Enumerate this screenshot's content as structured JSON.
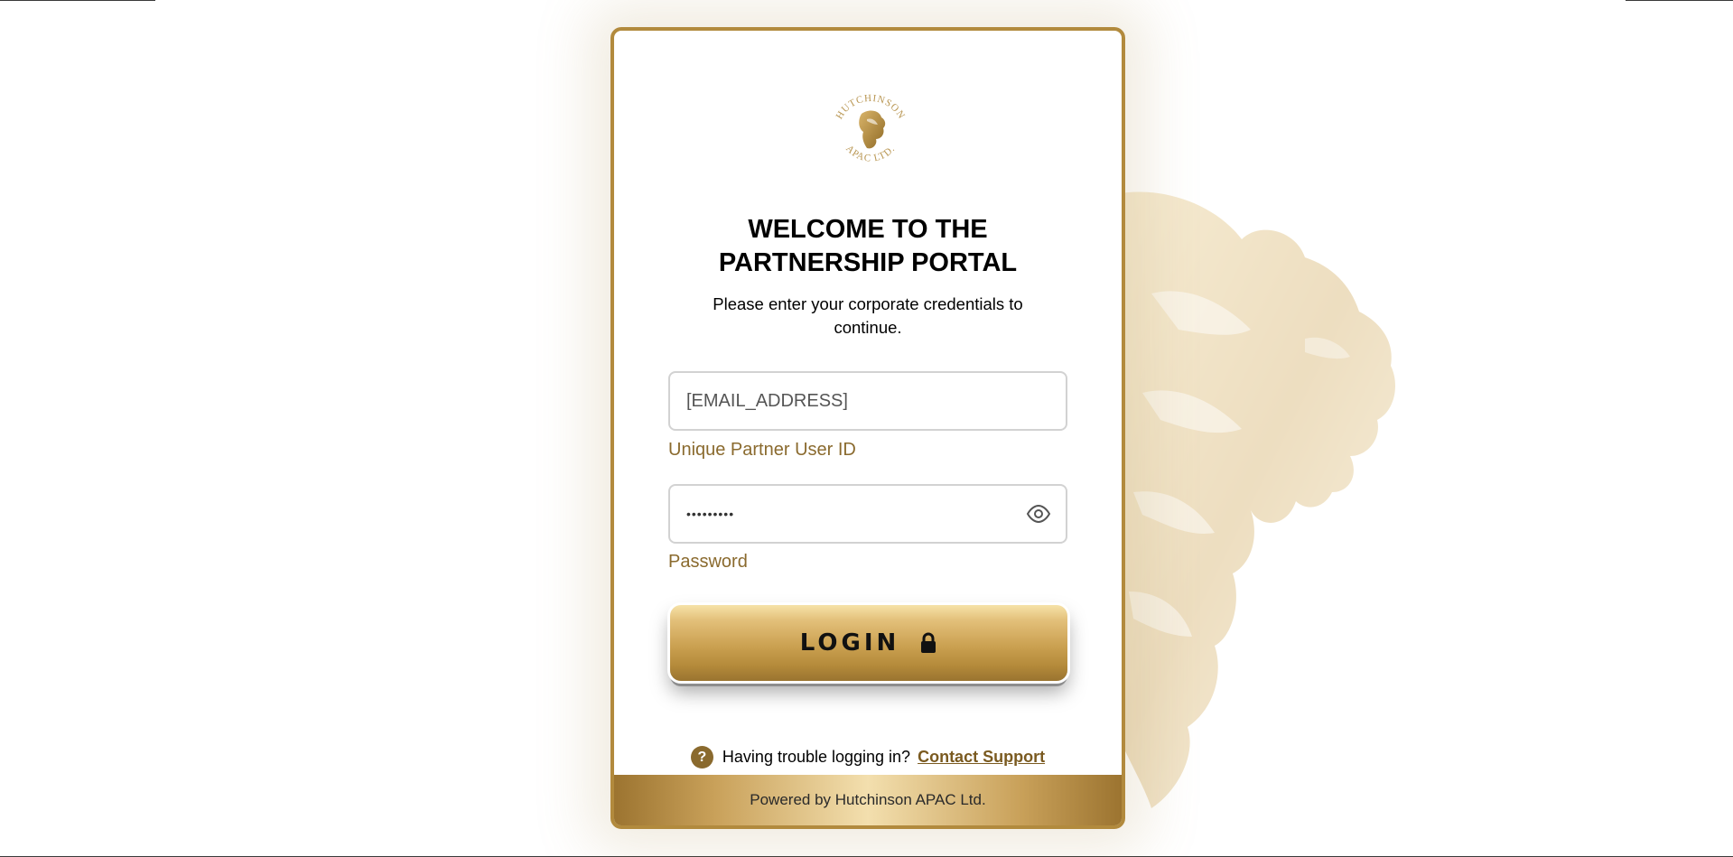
{
  "logo": {
    "arc_top": "HUTCHINSON",
    "arc_bottom": "APAC LTD."
  },
  "header": {
    "title": "WELCOME TO THE\nPARTNERSHIP PORTAL",
    "subtitle": "Please enter your corporate credentials to continue."
  },
  "form": {
    "email": {
      "value": "[EMAIL_ADDRESS]",
      "label": "Unique Partner User ID"
    },
    "password": {
      "value": "•••••••••",
      "label": "Password",
      "toggle_icon": "eye-icon"
    },
    "login_label": "LOGIN",
    "login_icon": "lock-icon"
  },
  "help": {
    "icon": "question-icon",
    "icon_glyph": "?",
    "text": "Having trouble logging in?",
    "link": "Contact Support"
  },
  "footer": {
    "text": "Powered by Hutchinson APAC Ltd."
  },
  "colors": {
    "gold": "#b28a3d",
    "gold_dark": "#8a6a2e",
    "link": "#7a5a20"
  }
}
